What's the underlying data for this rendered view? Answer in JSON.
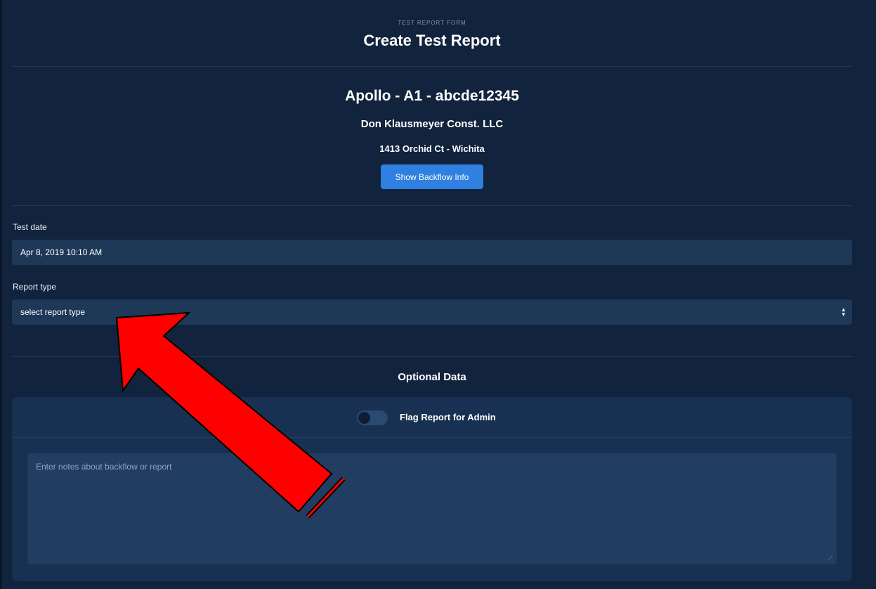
{
  "header": {
    "eyebrow": "TEST REPORT FORM",
    "title": "Create Test Report"
  },
  "device": {
    "title": "Apollo - A1 - abcde12345",
    "company": "Don Klausmeyer Const. LLC",
    "address": "1413 Orchid Ct - Wichita",
    "show_info_button": "Show Backflow Info"
  },
  "form": {
    "test_date_label": "Test date",
    "test_date_value": "Apr 8, 2019 10:10 AM",
    "report_type_label": "Report type",
    "report_type_value": "select report type"
  },
  "optional": {
    "title": "Optional Data",
    "flag_label": "Flag Report for Admin",
    "flag_on": false,
    "notes_placeholder": "Enter notes about backflow or report"
  },
  "colors": {
    "background": "#12243d",
    "input": "#1e3858",
    "button": "#2f80e0",
    "annotation_arrow": "#ff0000"
  }
}
